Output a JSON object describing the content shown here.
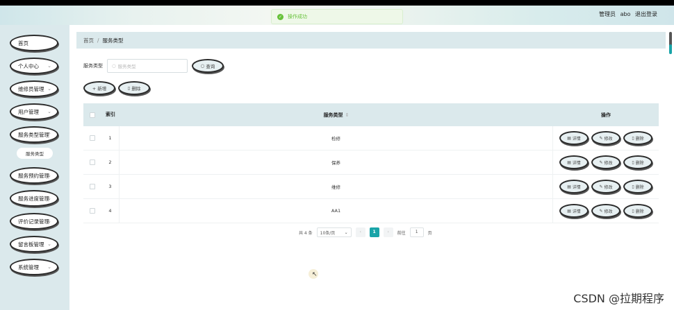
{
  "header": {
    "user_role": "管理员",
    "user_name": "abo",
    "logout_label": "退出登录"
  },
  "toast": {
    "message": "操作成功"
  },
  "sidebar": {
    "items": [
      {
        "label": "首页",
        "has_arrow": false
      },
      {
        "label": "个人中心",
        "has_arrow": true
      },
      {
        "label": "维修员管理",
        "has_arrow": true
      },
      {
        "label": "用户管理",
        "has_arrow": true
      },
      {
        "label": "服务类型管理",
        "has_arrow": true
      },
      {
        "label": "服务预约管理",
        "has_arrow": true
      },
      {
        "label": "服务进度管理",
        "has_arrow": true
      },
      {
        "label": "评价记录管理",
        "has_arrow": true
      },
      {
        "label": "留言板管理",
        "has_arrow": true
      },
      {
        "label": "系统管理",
        "has_arrow": true
      }
    ],
    "sub_item": "服务类型"
  },
  "breadcrumb": {
    "home": "首页",
    "separator": "/",
    "current": "服务类型"
  },
  "search": {
    "label": "服务类型",
    "placeholder": "服务类型",
    "button": "查询"
  },
  "actions": {
    "add": "+ 新增",
    "delete": "删除"
  },
  "table": {
    "headers": {
      "index": "索引",
      "type": "服务类型",
      "ops": "操作"
    },
    "rows": [
      {
        "index": "1",
        "type": "检修"
      },
      {
        "index": "2",
        "type": "保养"
      },
      {
        "index": "3",
        "type": "维修"
      },
      {
        "index": "4",
        "type": "AA1"
      }
    ],
    "row_actions": {
      "detail": "详情",
      "edit": "修改",
      "delete": "删除"
    }
  },
  "pagination": {
    "total": "共 4 条",
    "page_size": "10条/页",
    "current_page": "1",
    "goto_label": "前往",
    "goto_value": "1",
    "page_suffix": "页"
  },
  "watermark": "CSDN @拉期程序"
}
